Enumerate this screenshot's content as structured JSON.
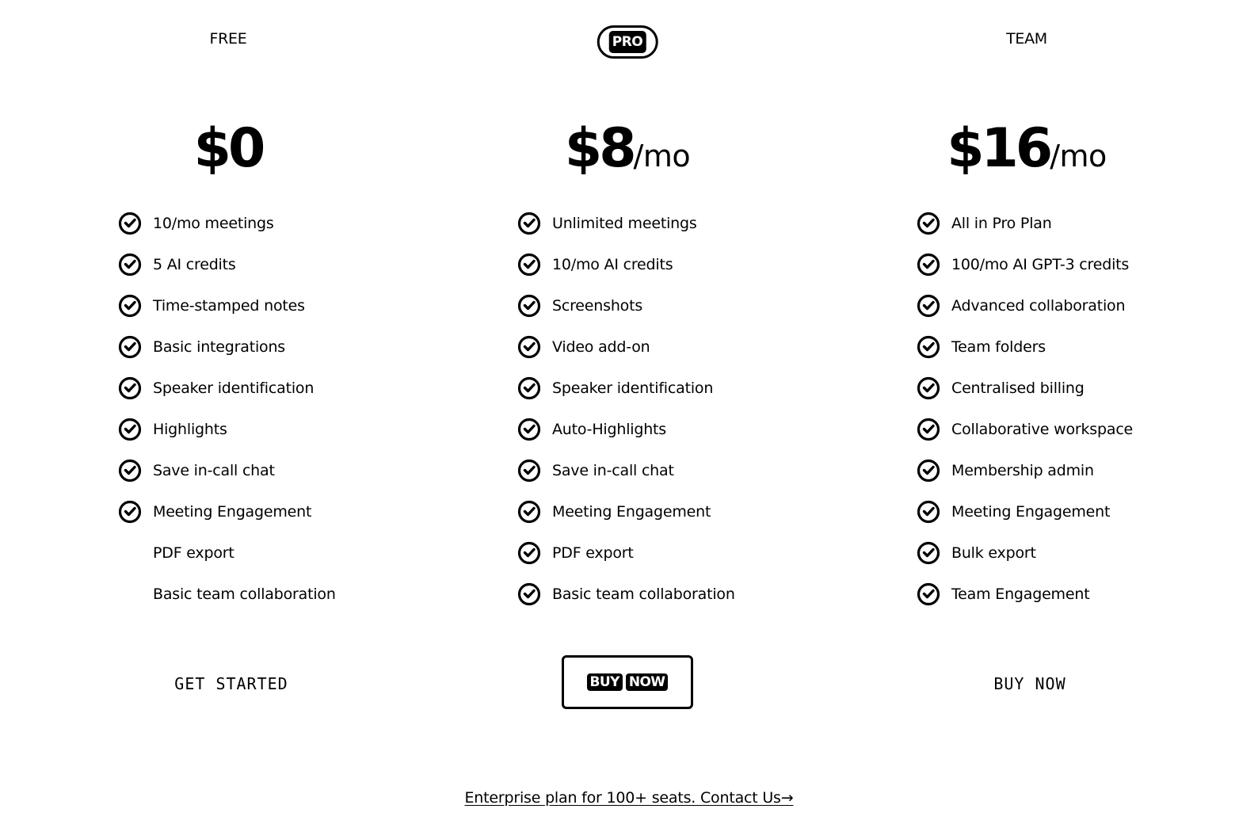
{
  "plans": [
    {
      "name": "FREE",
      "price": "$0",
      "per": "",
      "features": [
        {
          "label": "10/mo meetings",
          "included": true
        },
        {
          "label": "5 AI credits",
          "included": true
        },
        {
          "label": "Time-stamped notes",
          "included": true
        },
        {
          "label": "Basic integrations",
          "included": true
        },
        {
          "label": "Speaker identification",
          "included": true
        },
        {
          "label": "Highlights",
          "included": true
        },
        {
          "label": "Save in-call chat",
          "included": true
        },
        {
          "label": "Meeting Engagement",
          "included": true
        },
        {
          "label": "PDF export",
          "included": false
        },
        {
          "label": "Basic team collaboration",
          "included": false
        }
      ],
      "cta": "GET STARTED"
    },
    {
      "name": "PRO",
      "price": "$8",
      "per": "/mo",
      "features": [
        {
          "label": "Unlimited meetings",
          "included": true
        },
        {
          "label": "10/mo AI credits",
          "included": true
        },
        {
          "label": "Screenshots",
          "included": true
        },
        {
          "label": "Video add-on",
          "included": true
        },
        {
          "label": "Speaker identification",
          "included": true
        },
        {
          "label": "Auto-Highlights",
          "included": true
        },
        {
          "label": "Save in-call chat",
          "included": true
        },
        {
          "label": "Meeting Engagement",
          "included": true
        },
        {
          "label": "PDF export",
          "included": true
        },
        {
          "label": "Basic team collaboration",
          "included": true
        }
      ],
      "cta": "BUY NOW",
      "cta_words": [
        "BUY",
        "NOW"
      ]
    },
    {
      "name": "TEAM",
      "price": "$16",
      "per": "/mo",
      "features": [
        {
          "label": "All in Pro Plan",
          "included": true
        },
        {
          "label": "100/mo AI GPT-3 credits",
          "included": true
        },
        {
          "label": "Advanced collaboration",
          "included": true
        },
        {
          "label": "Team folders",
          "included": true
        },
        {
          "label": "Centralised billing",
          "included": true
        },
        {
          "label": "Collaborative workspace",
          "included": true
        },
        {
          "label": "Membership admin",
          "included": true
        },
        {
          "label": "Meeting Engagement",
          "included": true
        },
        {
          "label": "Bulk export",
          "included": true
        },
        {
          "label": "Team Engagement",
          "included": true
        }
      ],
      "cta": "BUY NOW"
    }
  ],
  "enterprise_link": "Enterprise plan for 100+ seats. Contact Us→",
  "icons": {
    "feature_check": "check-circle-icon"
  },
  "colors": {
    "background": "#ffffff",
    "foreground": "#000000"
  }
}
